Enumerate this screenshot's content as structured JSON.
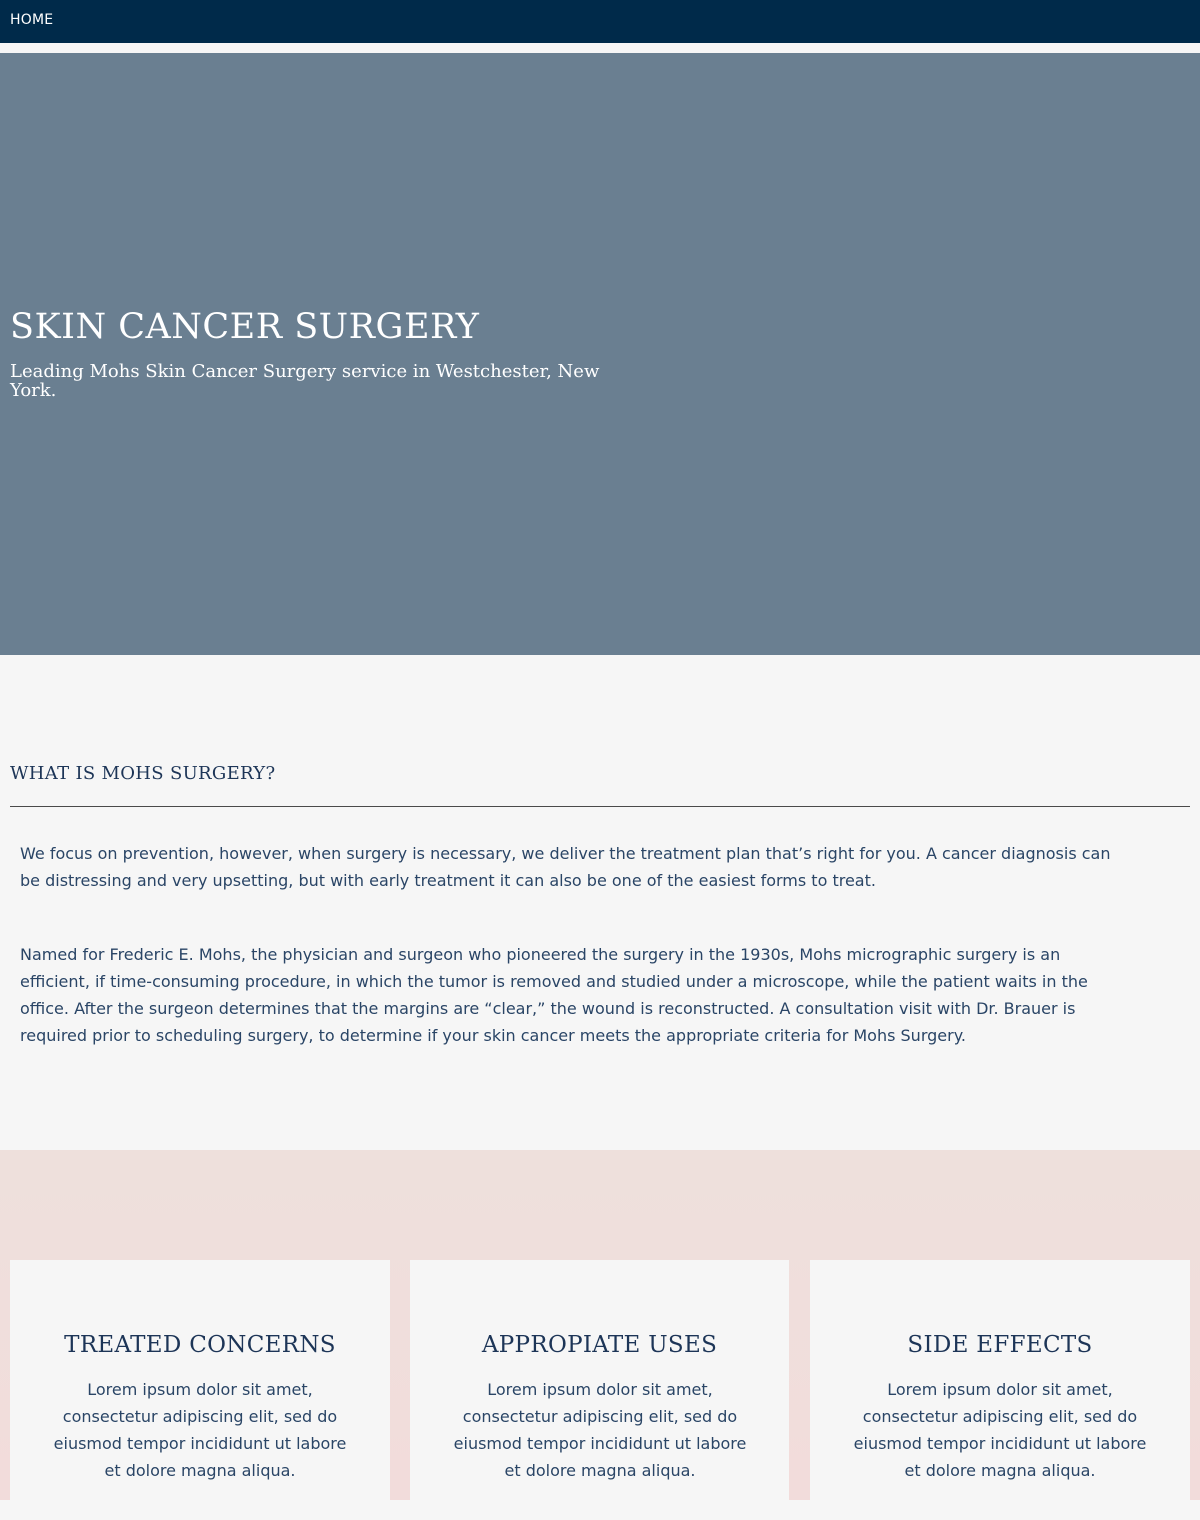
{
  "nav": {
    "home_label": "HOME"
  },
  "hero": {
    "title": "SKIN CANCER SURGERY",
    "subtitle": "Leading Mohs Skin Cancer Surgery service in Westchester, New York."
  },
  "about": {
    "heading": "WHAT IS MOHS SURGERY?",
    "paragraphs": [
      "We focus on prevention, however, when surgery is necessary, we deliver the treatment plan that’s right for you. A cancer diagnosis can be distressing and very upsetting, but with early treatment it can also be one of the easiest forms to treat.",
      "Named for Frederic E. Mohs, the physician and surgeon who pioneered the surgery in the 1930s, Mohs micrographic surgery is an efficient, if time-consuming procedure, in which the tumor is removed and studied under a microscope, while the patient waits in the office. After the surgeon determines that the margins are “clear,” the wound is reconstructed. A consultation visit with Dr. Brauer is required prior to scheduling surgery, to determine if your skin cancer meets the appropriate criteria for Mohs Surgery."
    ]
  },
  "cards": [
    {
      "title": "TREATED CONCERNS",
      "text": "Lorem ipsum dolor sit amet, consectetur adipiscing elit, sed do eiusmod tempor incididunt ut labore et dolore magna aliqua."
    },
    {
      "title": "APPROPIATE USES",
      "text": "Lorem ipsum dolor sit amet, consectetur adipiscing elit, sed do eiusmod tempor incididunt ut labore et dolore magna aliqua."
    },
    {
      "title": "SIDE EFFECTS",
      "text": "Lorem ipsum dolor sit amet, consectetur adipiscing elit, sed do eiusmod tempor incididunt ut labore et dolore magna aliqua."
    }
  ],
  "colors": {
    "nav_bg": "#002a4a",
    "hero_bg": "#6a7f91",
    "page_bg": "#f6f6f6",
    "text_navy": "#1d3557",
    "features_bg": "#f2dcdb"
  }
}
